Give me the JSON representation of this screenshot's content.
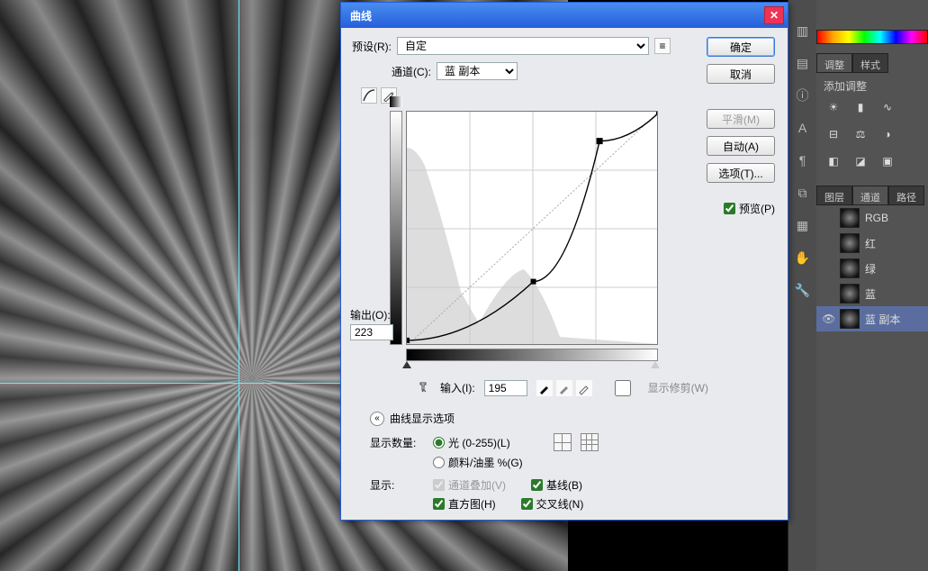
{
  "dialog": {
    "title": "曲线",
    "preset_label": "预设(R):",
    "preset_value": "自定",
    "channel_label": "通道(C):",
    "channel_value": "蓝 副本",
    "output_label": "输出(O):",
    "output_value": "223",
    "input_label": "输入(I):",
    "input_value": "195",
    "show_clip_label": "显示修剪(W)",
    "display_options_label": "曲线显示选项",
    "amount_label": "显示数量:",
    "amount_light": "光 (0-255)(L)",
    "amount_pigment": "颜料/油墨 %(G)",
    "show_label": "显示:",
    "overlay_label": "通道叠加(V)",
    "baseline_label": "基线(B)",
    "histogram_label": "直方图(H)",
    "intersection_label": "交叉线(N)",
    "buttons": {
      "ok": "确定",
      "cancel": "取消",
      "smooth": "平滑(M)",
      "auto": "自动(A)",
      "options": "选项(T)..."
    },
    "preview_label": "预览(P)"
  },
  "right": {
    "adjust_tab": "调整",
    "style_tab": "样式",
    "add_adjust": "添加调整",
    "layers_tab": "图层",
    "channels_tab": "通道",
    "paths_tab": "路径",
    "channels": [
      {
        "name": "RGB"
      },
      {
        "name": "红"
      },
      {
        "name": "绿"
      },
      {
        "name": "蓝"
      },
      {
        "name": "蓝 副本"
      }
    ]
  },
  "chart_data": {
    "type": "line",
    "title": "曲线 (蓝 副本)",
    "xlabel": "输入",
    "ylabel": "输出",
    "xlim": [
      0,
      255
    ],
    "ylim": [
      0,
      255
    ],
    "points": [
      {
        "x": 0,
        "y": 6
      },
      {
        "x": 128,
        "y": 70
      },
      {
        "x": 195,
        "y": 223
      },
      {
        "x": 255,
        "y": 254
      }
    ],
    "selected_point": {
      "x": 195,
      "y": 223
    }
  }
}
